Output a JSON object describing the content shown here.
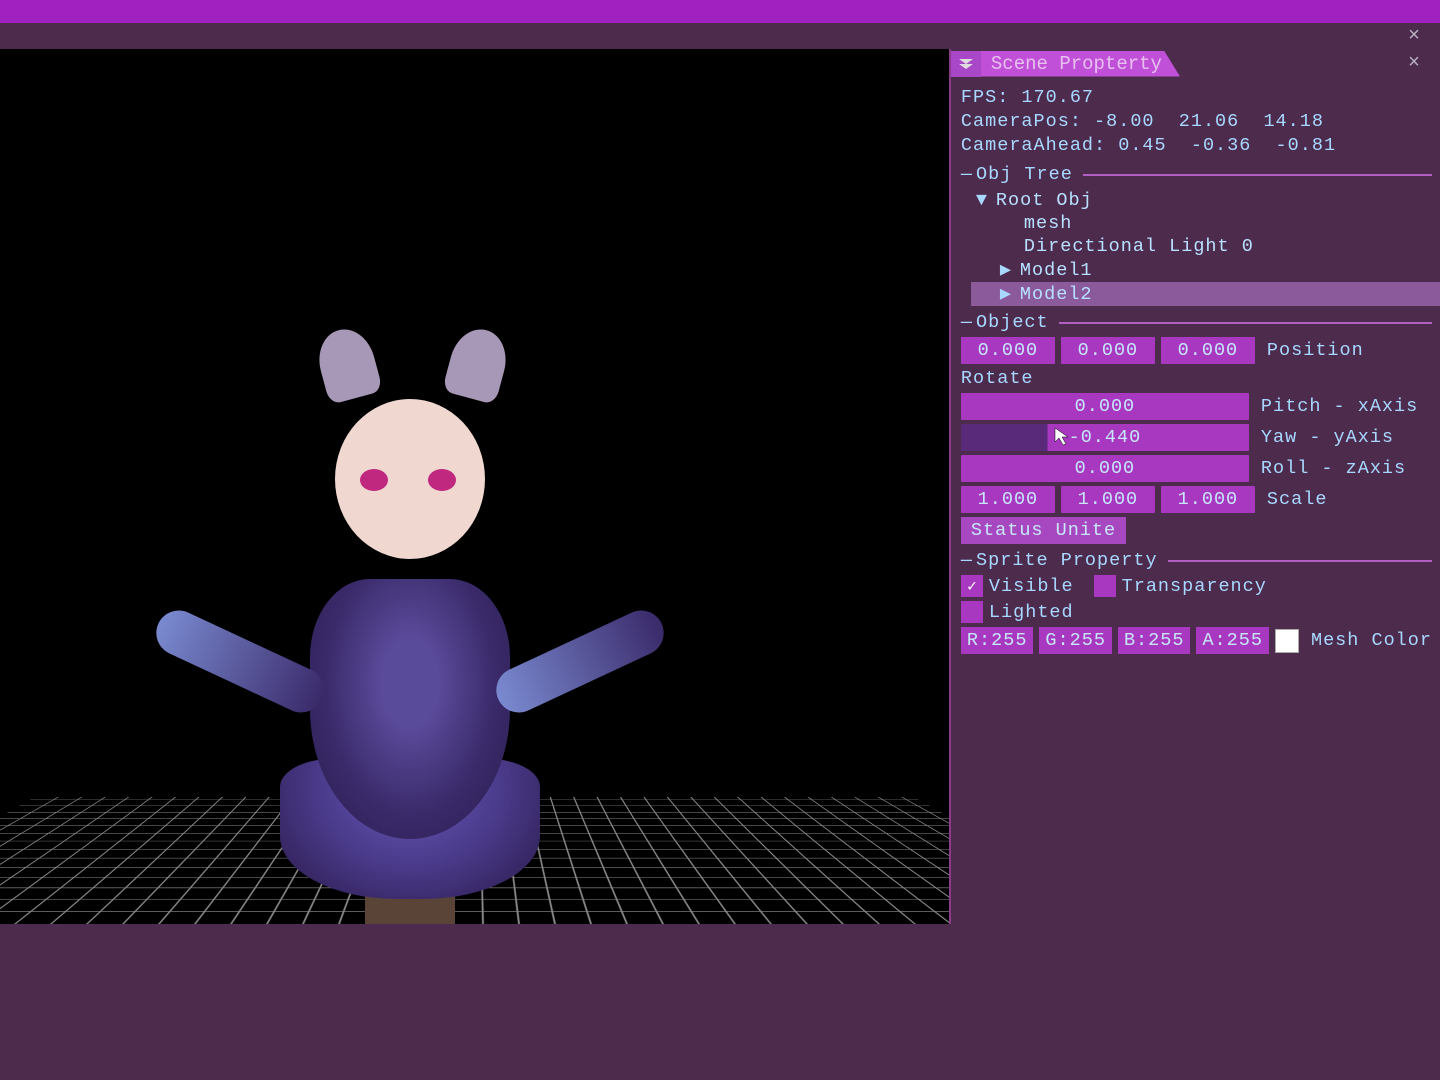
{
  "panel": {
    "title": "Scene Propterty"
  },
  "stats": {
    "fps": "FPS: 170.67",
    "cameraPos": "CameraPos: -8.00  21.06  14.18",
    "cameraAhead": "CameraAhead: 0.45  -0.36  -0.81"
  },
  "sections": {
    "objTree": "Obj Tree",
    "object": "Object",
    "sprite": "Sprite Property"
  },
  "tree": {
    "root": "Root Obj",
    "mesh": "mesh",
    "light": "Directional Light 0",
    "model1": "Model1",
    "model2": "Model2"
  },
  "object": {
    "position": {
      "x": "0.000",
      "y": "0.000",
      "z": "0.000",
      "label": "Position"
    },
    "rotateLabel": "Rotate",
    "pitch": {
      "value": "0.000",
      "label": "Pitch - xAxis"
    },
    "yaw": {
      "value": "-0.440",
      "label": "Yaw - yAxis"
    },
    "roll": {
      "value": "0.000",
      "label": "Roll - zAxis"
    },
    "scale": {
      "x": "1.000",
      "y": "1.000",
      "z": "1.000",
      "label": "Scale"
    },
    "statusUnite": "Status Unite"
  },
  "sprite": {
    "visible": "Visible",
    "transparency": "Transparency",
    "lighted": "Lighted",
    "r": "R:255",
    "g": "G:255",
    "b": "B:255",
    "a": "A:255",
    "meshColor": "Mesh Color"
  }
}
